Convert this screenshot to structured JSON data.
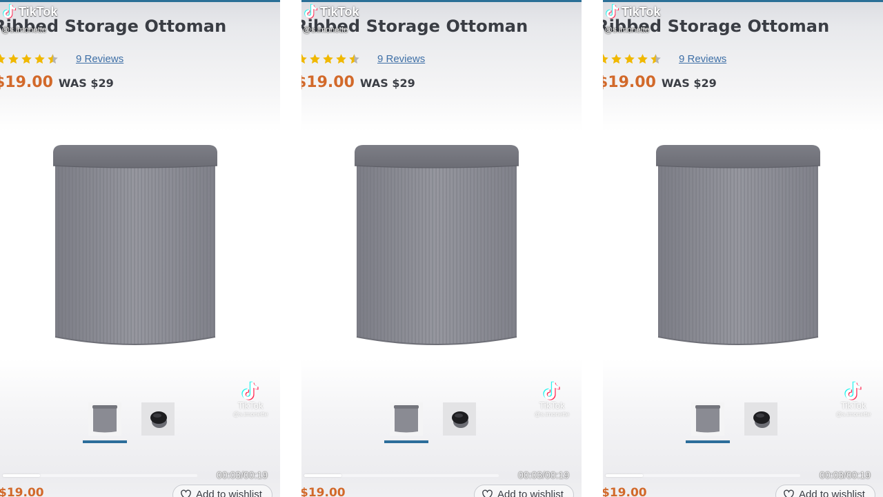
{
  "tiktok": {
    "brand": "TikTok",
    "username": "@s.imonette",
    "watermark_brand": "TikTok",
    "watermark_username": "@s.imonette"
  },
  "product": {
    "title": "Ribbed Storage Ottoman",
    "rating_stars": 4.5,
    "rating_max": 5,
    "reviews_label": "9 Reviews",
    "price_now": "$19.00",
    "price_was": "WAS $29"
  },
  "gallery": {
    "thumbnails": [
      "ottoman-front",
      "ottoman-top"
    ],
    "selected_index": 0
  },
  "player": {
    "time": "00:03/00:19",
    "progress": 0.19
  },
  "footer": {
    "price": "$19.00",
    "wishlist_label": "Add to wishlist"
  },
  "colors": {
    "price_accent": "#d2692a",
    "link": "#3e6fa6",
    "underline_accent": "#2c6d9a",
    "star": "#f0b800",
    "ottoman": "#8d8e96"
  }
}
